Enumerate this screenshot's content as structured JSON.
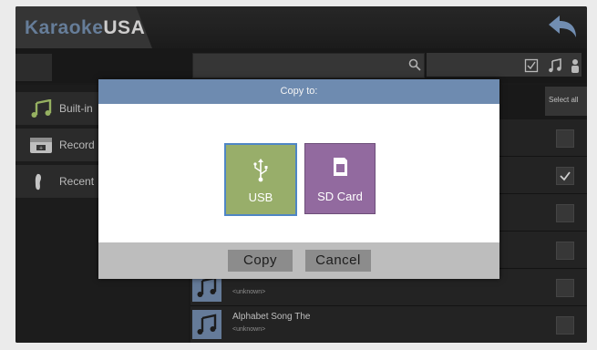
{
  "app": {
    "logo_part1": "Karaoke",
    "logo_part2": "USA"
  },
  "sidebar": {
    "items": [
      {
        "label": "Built-in",
        "icon": "music-note-icon"
      },
      {
        "label": "Record",
        "icon": "record-box-icon"
      },
      {
        "label": "Recent",
        "icon": "footprint-icon"
      }
    ]
  },
  "list": {
    "select_all": "Select all",
    "rows": [
      {
        "title": "",
        "subtitle": "<unknown>",
        "checked": false
      },
      {
        "title": "Alphabet Song The",
        "subtitle": "<unknown>",
        "checked": false
      }
    ]
  },
  "dialog": {
    "title": "Copy to:",
    "options": [
      {
        "label": "USB",
        "icon": "usb-icon",
        "selected": true
      },
      {
        "label": "SD Card",
        "icon": "sd-card-icon",
        "selected": false
      }
    ],
    "copy_label": "Copy",
    "cancel_label": "Cancel"
  },
  "colors": {
    "accent": "#6e8bb0",
    "usb_tile": "#98ae6a",
    "sd_tile": "#926a9f",
    "selection_border": "#4f86c5"
  }
}
